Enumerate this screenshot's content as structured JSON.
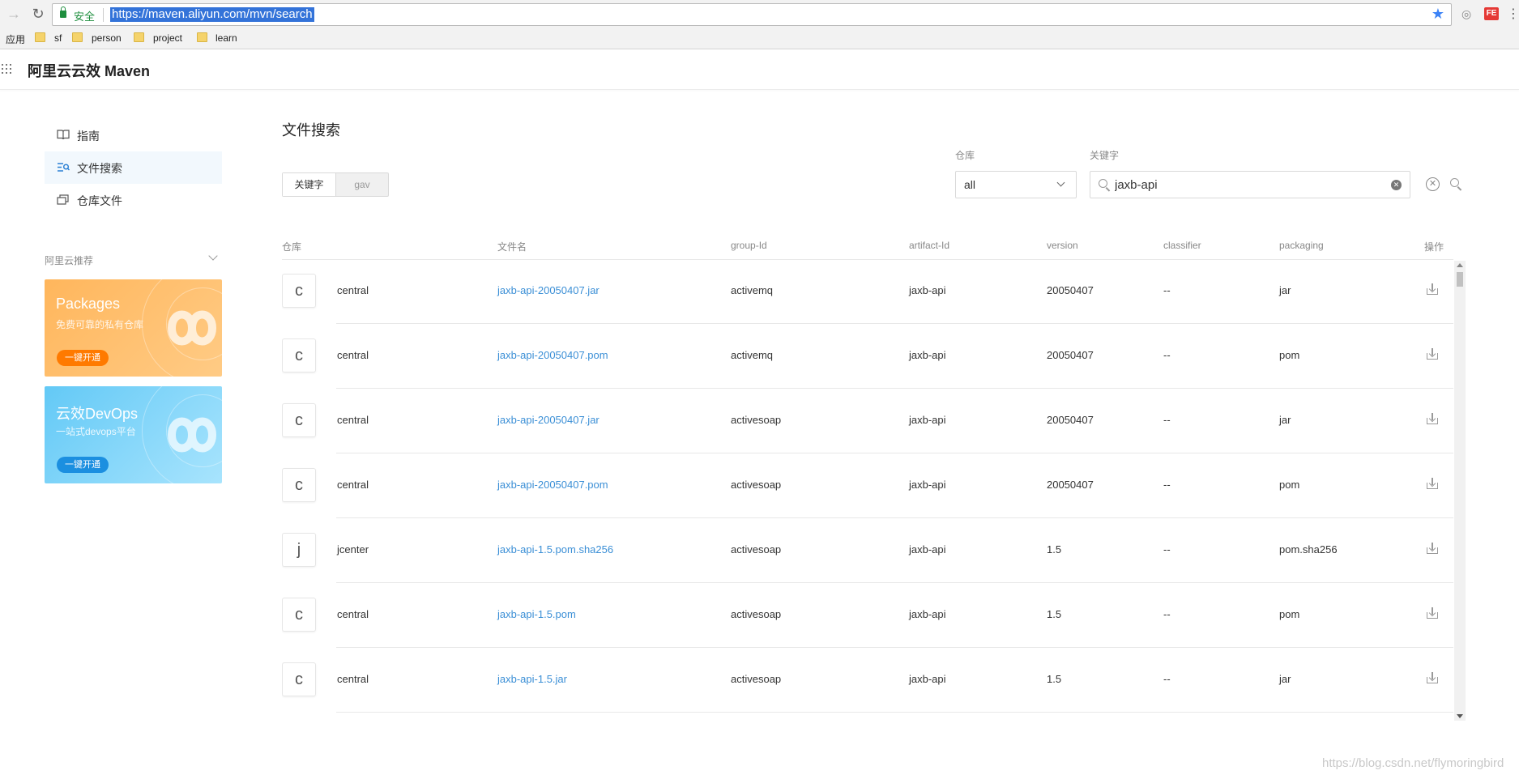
{
  "browser": {
    "secure_label": "安全",
    "url": "https://maven.aliyun.com/mvn/search",
    "bookmarks": {
      "apps": "应用",
      "items": [
        "sf",
        "person",
        "project",
        "learn"
      ]
    },
    "extension_fe": "FE"
  },
  "app": {
    "title": "阿里云云效 Maven"
  },
  "sidebar": {
    "items": [
      {
        "label": "指南",
        "icon": "book-icon"
      },
      {
        "label": "文件搜索",
        "icon": "search-list-icon"
      },
      {
        "label": "仓库文件",
        "icon": "copy-icon"
      }
    ],
    "section_title": "阿里云推荐",
    "promos": [
      {
        "title": "Packages",
        "subtitle": "免费可靠的私有仓库",
        "button": "一键开通"
      },
      {
        "title": "云效DevOps",
        "subtitle": "一站式devops平台",
        "button": "一键开通"
      }
    ]
  },
  "main": {
    "title": "文件搜索",
    "tabs": [
      "关键字",
      "gav"
    ],
    "filters": {
      "repo_label": "仓库",
      "repo_value": "all",
      "keyword_label": "关键字",
      "keyword_value": "jaxb-api"
    },
    "columns": [
      "仓库",
      "文件名",
      "group-Id",
      "artifact-Id",
      "version",
      "classifier",
      "packaging",
      "操作"
    ],
    "rows": [
      {
        "avatar": "c",
        "repo": "central",
        "file": "jaxb-api-20050407.jar",
        "group": "activemq",
        "artifact": "jaxb-api",
        "version": "20050407",
        "classifier": "--",
        "packaging": "jar"
      },
      {
        "avatar": "c",
        "repo": "central",
        "file": "jaxb-api-20050407.pom",
        "group": "activemq",
        "artifact": "jaxb-api",
        "version": "20050407",
        "classifier": "--",
        "packaging": "pom"
      },
      {
        "avatar": "c",
        "repo": "central",
        "file": "jaxb-api-20050407.jar",
        "group": "activesoap",
        "artifact": "jaxb-api",
        "version": "20050407",
        "classifier": "--",
        "packaging": "jar"
      },
      {
        "avatar": "c",
        "repo": "central",
        "file": "jaxb-api-20050407.pom",
        "group": "activesoap",
        "artifact": "jaxb-api",
        "version": "20050407",
        "classifier": "--",
        "packaging": "pom"
      },
      {
        "avatar": "j",
        "repo": "jcenter",
        "file": "jaxb-api-1.5.pom.sha256",
        "group": "activesoap",
        "artifact": "jaxb-api",
        "version": "1.5",
        "classifier": "--",
        "packaging": "pom.sha256"
      },
      {
        "avatar": "c",
        "repo": "central",
        "file": "jaxb-api-1.5.pom",
        "group": "activesoap",
        "artifact": "jaxb-api",
        "version": "1.5",
        "classifier": "--",
        "packaging": "pom"
      },
      {
        "avatar": "c",
        "repo": "central",
        "file": "jaxb-api-1.5.jar",
        "group": "activesoap",
        "artifact": "jaxb-api",
        "version": "1.5",
        "classifier": "--",
        "packaging": "jar"
      }
    ]
  },
  "watermark": "https://blog.csdn.net/flymoringbird",
  "colors": {
    "link": "#3b8fd6",
    "accent_orange": "#ff7a00",
    "accent_blue": "#1b8fe0",
    "secure_green": "#1e8e3e"
  }
}
